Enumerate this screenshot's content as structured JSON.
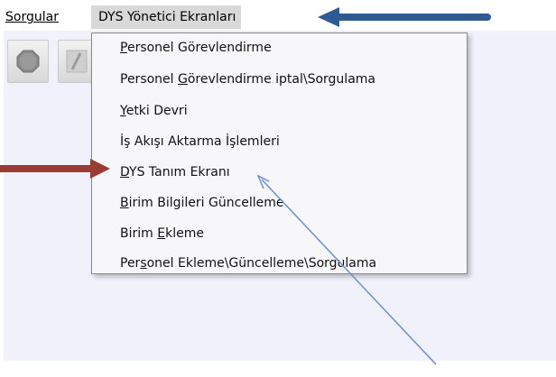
{
  "menubar": {
    "items": [
      {
        "label": "Sorgular"
      },
      {
        "label": "DYS Yönetici Ekranları"
      }
    ]
  },
  "toolbar": {
    "buttons": [
      {
        "icon": "stop-icon"
      },
      {
        "icon": "edit-icon"
      }
    ]
  },
  "dropdown": {
    "items": [
      {
        "label": "Personel Görevlendirme",
        "mnemonic": "P"
      },
      {
        "label": "Personel Görevlendirme iptal\\Sorgulama",
        "mnemonic": "G"
      },
      {
        "label": "Yetki Devri",
        "mnemonic": "Y"
      },
      {
        "label": "İş Akışı Aktarma İşlemleri",
        "mnemonic": ""
      },
      {
        "label": "DYS Tanım Ekranı",
        "mnemonic": "D"
      },
      {
        "label": "Birim Bilgileri Güncelleme",
        "mnemonic": "B"
      },
      {
        "label": "Birim Ekleme",
        "mnemonic": "E"
      },
      {
        "label": "Personel Ekleme\\Güncelleme\\Sorgulama",
        "mnemonic": "s"
      }
    ]
  },
  "colors": {
    "menu_highlight": "#d9d9d9",
    "app_background": "#f1f1fb",
    "dropdown_background": "#f7f7fa",
    "annotation_blue_arrow": "#2e5b94",
    "annotation_red_arrow": "#9a3b34",
    "annotation_pointer_line": "#6b8ed0"
  }
}
